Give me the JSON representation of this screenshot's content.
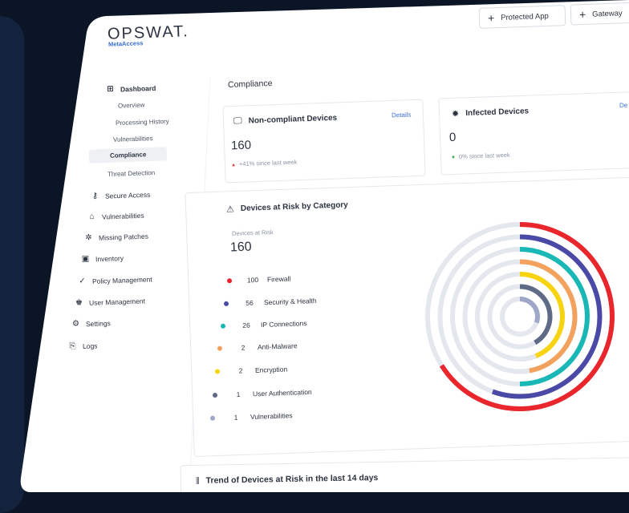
{
  "brand": {
    "name": "OPSWAT.",
    "product": "MetaAccess"
  },
  "top_actions": [
    {
      "label": "Protected App"
    },
    {
      "label": "Gateway"
    }
  ],
  "sidebar": {
    "items": [
      {
        "label": "Dashboard",
        "icon": "grid-icon"
      },
      {
        "label": "Overview"
      },
      {
        "label": "Processing History"
      },
      {
        "label": "Vulnerabilities"
      },
      {
        "label": "Compliance",
        "active": true
      },
      {
        "label": "Threat Detection"
      },
      {
        "label": "Secure Access",
        "icon": "key-icon"
      },
      {
        "label": "Vulnerabilities",
        "icon": "lock-icon"
      },
      {
        "label": "Missing Patches",
        "icon": "patch-icon"
      },
      {
        "label": "Inventory",
        "icon": "inventory-icon"
      },
      {
        "label": "Policy Management",
        "icon": "policy-icon"
      },
      {
        "label": "User Management",
        "icon": "users-icon"
      },
      {
        "label": "Settings",
        "icon": "gear-icon"
      },
      {
        "label": "Logs",
        "icon": "logs-icon"
      }
    ]
  },
  "page": {
    "title": "Compliance"
  },
  "cards": {
    "non_compliant": {
      "title": "Non-compliant Devices",
      "link": "Details",
      "value": "160",
      "trend": "+41% since last week",
      "trend_direction": "up"
    },
    "infected": {
      "title": "Infected Devices",
      "link": "De",
      "value": "0",
      "trend": "0% since last week",
      "trend_direction": "down"
    }
  },
  "risk": {
    "title": "Devices at Risk by Category",
    "label": "Devices at Risk",
    "total": "160",
    "categories": [
      {
        "value": "100",
        "name": "Firewall",
        "color": "#e8262b"
      },
      {
        "value": "56",
        "name": "Security & Health",
        "color": "#4b49a6"
      },
      {
        "value": "26",
        "name": "IP Connections",
        "color": "#19b7b5"
      },
      {
        "value": "2",
        "name": "Anti-Malware",
        "color": "#f2a25d"
      },
      {
        "value": "2",
        "name": "Encryption",
        "color": "#f7d40f"
      },
      {
        "value": "1",
        "name": "User Authentication",
        "color": "#5e6a86"
      },
      {
        "value": "1",
        "name": "Vulnerabilities",
        "color": "#9ea7c8"
      }
    ]
  },
  "bottom": {
    "title": "Trend of Devices at Risk in the last 14 days"
  },
  "colors": {
    "accent": "#3b6fd8",
    "background": "#0b1526",
    "surface": "#ffffff"
  }
}
